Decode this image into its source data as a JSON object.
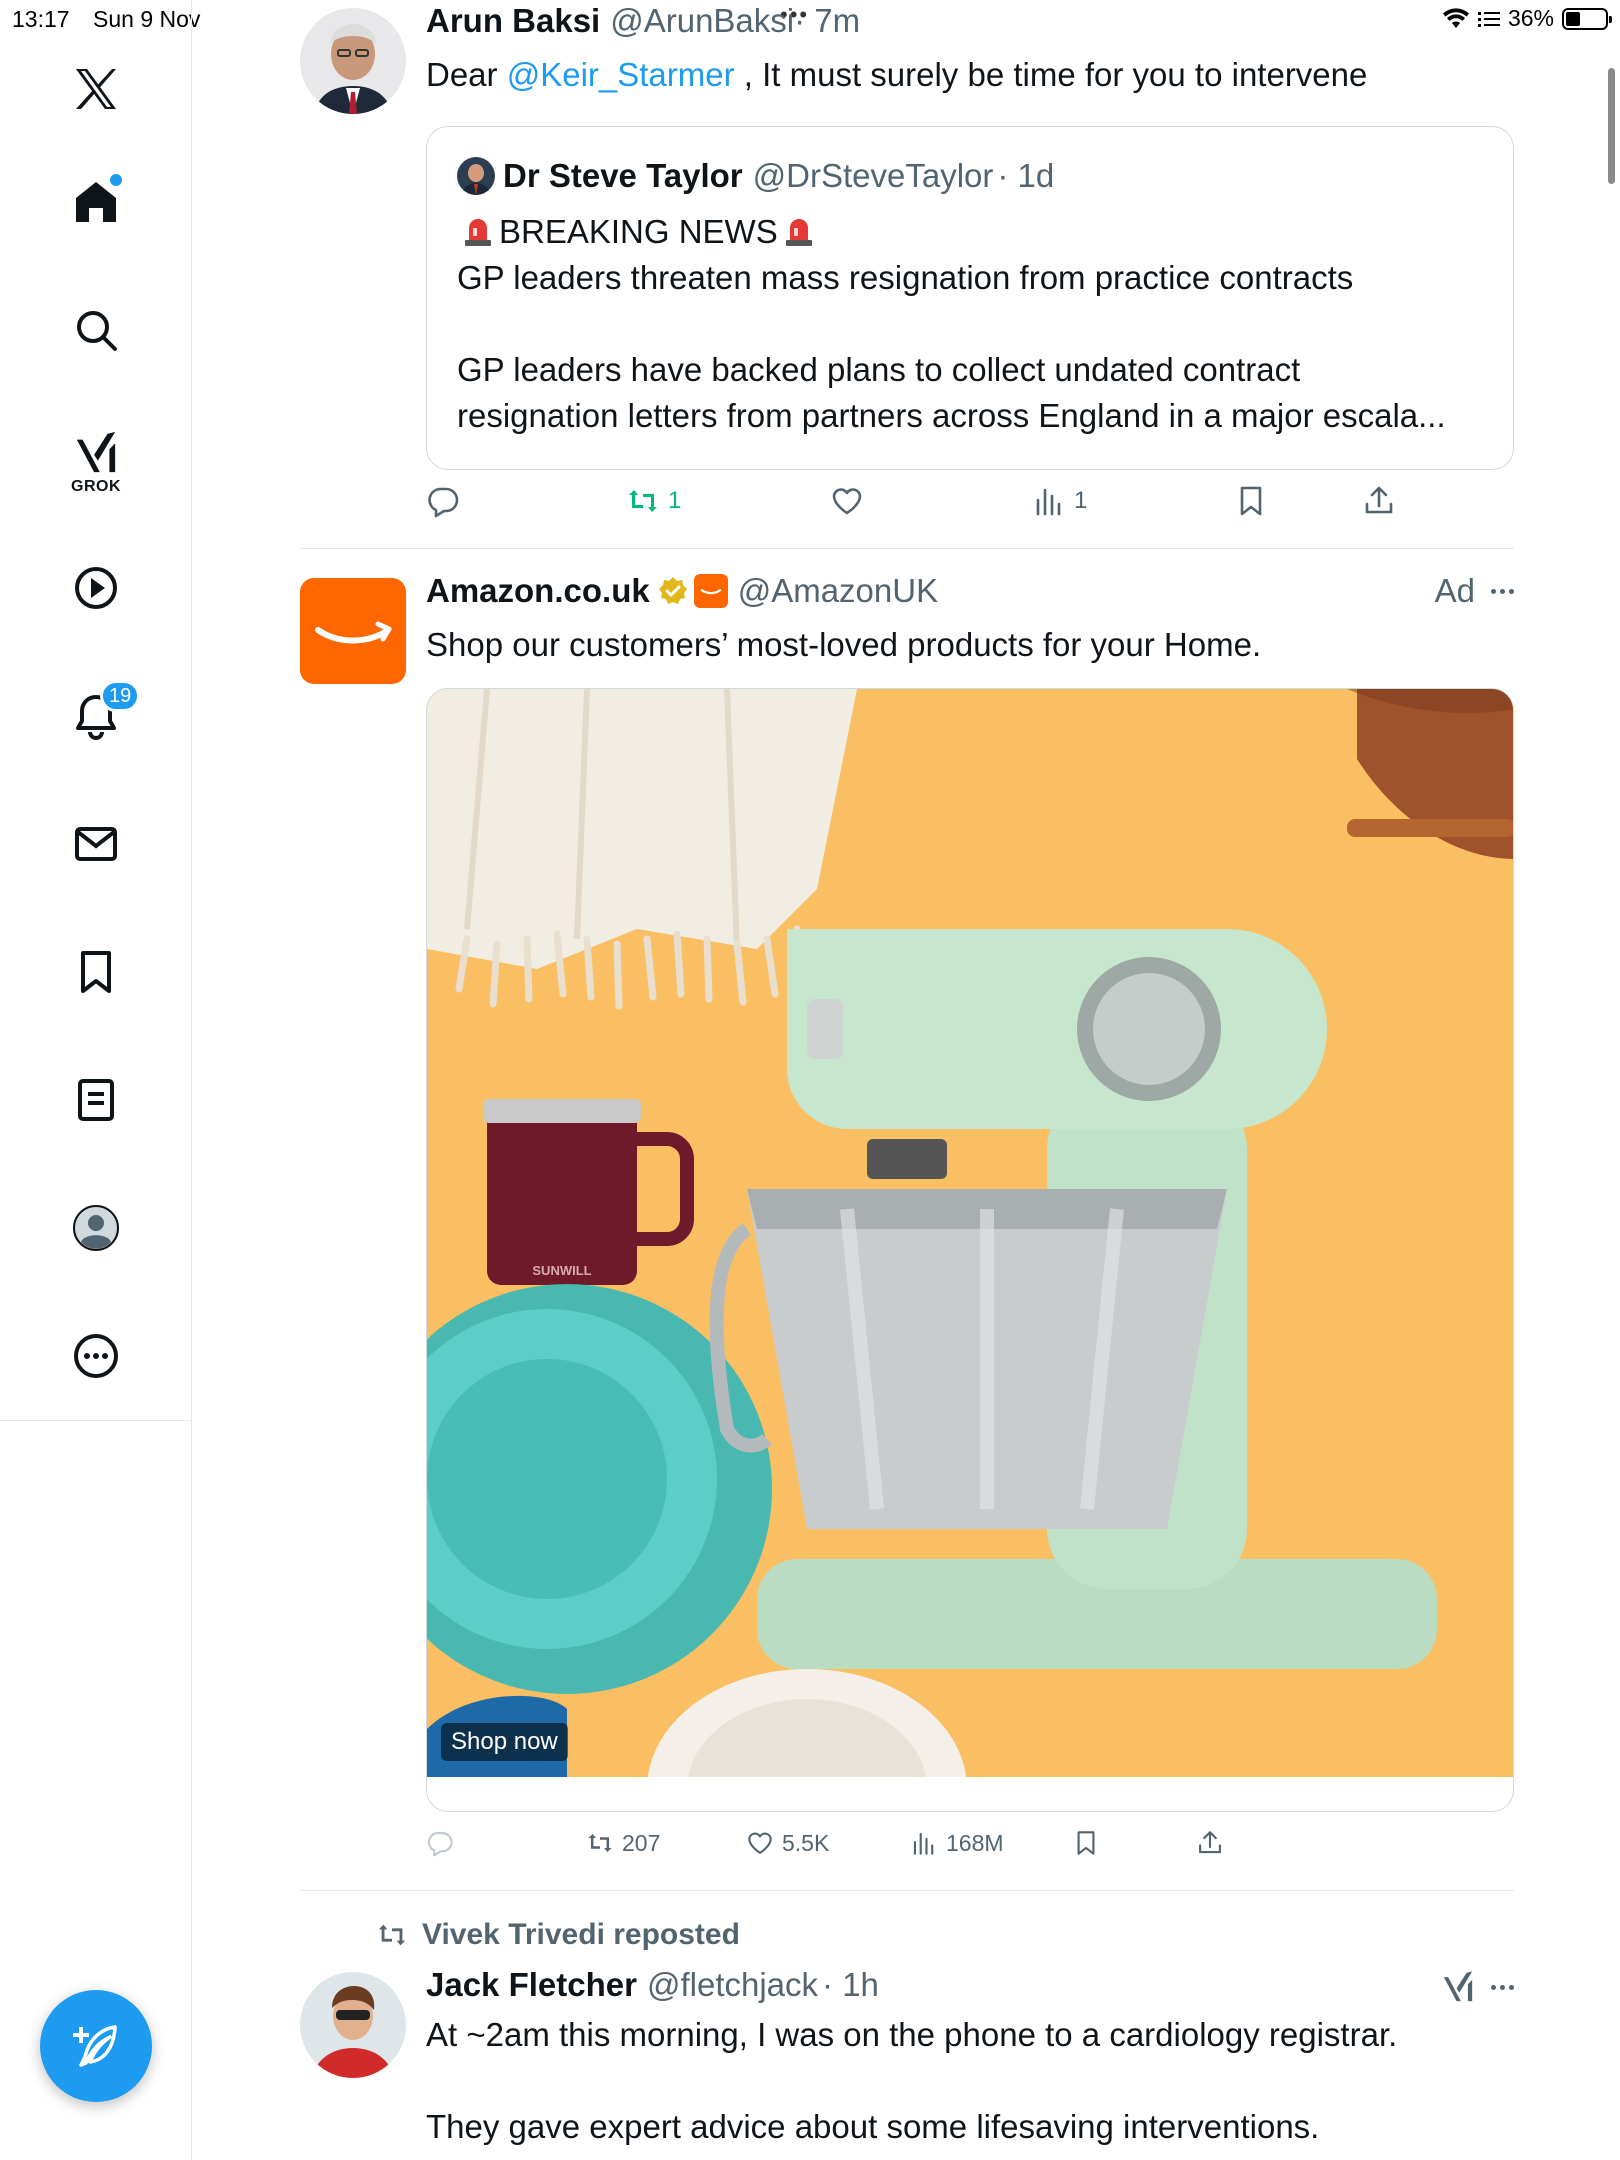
{
  "status_bar": {
    "time": "13:17",
    "date": "Sun 9 Nov",
    "battery": "36%",
    "battery_level": 0.36
  },
  "sidebar": {
    "items": [
      {
        "label": "",
        "icon": "x-logo-icon"
      },
      {
        "label": "",
        "icon": "home-icon",
        "has_dot": true
      },
      {
        "label": "",
        "icon": "search-icon"
      },
      {
        "label": "GROK",
        "icon": "grok-icon"
      },
      {
        "label": "",
        "icon": "video-icon"
      },
      {
        "label": "",
        "icon": "bell-icon",
        "badge": "19"
      },
      {
        "label": "",
        "icon": "mail-icon"
      },
      {
        "label": "",
        "icon": "bookmark-icon"
      },
      {
        "label": "",
        "icon": "list-icon"
      },
      {
        "label": "",
        "icon": "profile-icon"
      },
      {
        "label": "",
        "icon": "more-icon"
      }
    ],
    "compose_icon": "compose-icon"
  },
  "tweets": [
    {
      "name": "Arun Baksi",
      "handle": "@ArunBaksi",
      "time": "· 7m",
      "text_prefix": "Dear ",
      "mention": "@Keir_Starmer",
      "text_suffix": " , It must surely be time for you to intervene",
      "quote": {
        "name": "Dr Steve Taylor",
        "handle": "@DrSteveTaylor",
        "time": "· 1d",
        "headline": "BREAKING NEWS",
        "line1": "GP leaders threaten mass resignation from practice contracts",
        "line2": "GP leaders have backed plans to collect undated contract",
        "line3": "resignation letters from partners across England in a major escala..."
      },
      "actions": {
        "replies": "",
        "reposts": "1",
        "likes": "",
        "views": "1"
      }
    },
    {
      "name": "Amazon.co.uk",
      "handle": "@AmazonUK",
      "ad_label": "Ad",
      "text": "Shop our customers’ most-loved products for your Home.",
      "media_cta": "Shop now",
      "mug_brand": "SUNWILL",
      "actions": {
        "replies": "",
        "reposts": "207",
        "likes": "5.5K",
        "views": "168M"
      }
    },
    {
      "reposted_by": "Vivek Trivedi reposted",
      "name": "Jack Fletcher",
      "handle": "@fletchjack",
      "time": "· 1h",
      "line1": "At ~2am this morning, I was on the phone to a cardiology registrar.",
      "line2": "They gave expert advice about some lifesaving interventions."
    }
  ],
  "colors": {
    "accent": "#1d9bf0",
    "repost_green": "#00ba7c",
    "amazon_orange": "#ff6600",
    "ad_background": "#fbbf63"
  }
}
